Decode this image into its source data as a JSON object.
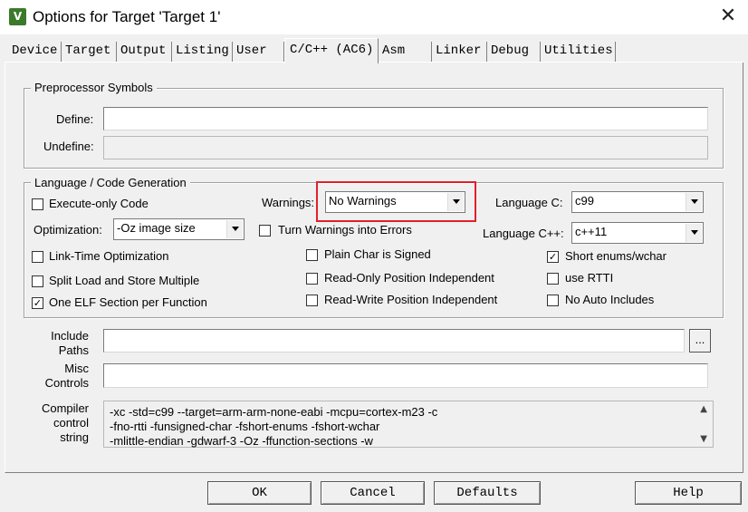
{
  "window": {
    "title": "Options for Target 'Target 1'",
    "icon": "uvision-icon",
    "close_glyph": "✕"
  },
  "tabs": [
    {
      "label": "Device",
      "active": false
    },
    {
      "label": "Target",
      "active": false
    },
    {
      "label": "Output",
      "active": false
    },
    {
      "label": "Listing",
      "active": false
    },
    {
      "label": "User",
      "active": false
    },
    {
      "label": "C/C++ (AC6)",
      "active": true
    },
    {
      "label": "Asm",
      "active": false
    },
    {
      "label": "Linker",
      "active": false
    },
    {
      "label": "Debug",
      "active": false
    },
    {
      "label": "Utilities",
      "active": false
    }
  ],
  "preprocessor": {
    "legend": "Preprocessor Symbols",
    "define_label": "Define:",
    "define_value": "",
    "undefine_label": "Undefine:",
    "undefine_value": ""
  },
  "codegen": {
    "legend": "Language / Code Generation",
    "execute_only": {
      "label": "Execute-only Code",
      "checked": false
    },
    "optimization_label": "Optimization:",
    "optimization_value": "-Oz image size",
    "lto": {
      "label": "Link-Time Optimization",
      "checked": false
    },
    "split_ldm": {
      "label": "Split Load and Store Multiple",
      "checked": false
    },
    "one_elf": {
      "label": "One ELF Section per Function",
      "checked": true
    },
    "warnings_label": "Warnings:",
    "warnings_value": "No Warnings",
    "warnings_to_errors": {
      "label": "Turn Warnings into Errors",
      "checked": false
    },
    "plain_char": {
      "label": "Plain Char is Signed",
      "checked": false
    },
    "ropi": {
      "label": "Read-Only Position Independent",
      "checked": false
    },
    "rwpi": {
      "label": "Read-Write Position Independent",
      "checked": false
    },
    "language_c_label": "Language C:",
    "language_c_value": "c99",
    "language_cpp_label": "Language C++:",
    "language_cpp_value": "c++11",
    "short_enums": {
      "label": "Short enums/wchar",
      "checked": true
    },
    "rtti": {
      "label": "use RTTI",
      "checked": false
    },
    "no_auto_includes": {
      "label": "No Auto Includes",
      "checked": false
    }
  },
  "include_paths": {
    "label_line1": "Include",
    "label_line2": "Paths",
    "value": "",
    "browse_label": "..."
  },
  "misc_controls": {
    "label_line1": "Misc",
    "label_line2": "Controls",
    "value": ""
  },
  "compiler_control": {
    "label_line1": "Compiler",
    "label_line2": "control",
    "label_line3": "string",
    "lines": [
      "-xc -std=c99 --target=arm-arm-none-eabi -mcpu=cortex-m23 -c",
      "-fno-rtti -funsigned-char -fshort-enums -fshort-wchar",
      "-mlittle-endian -gdwarf-3 -Oz -ffunction-sections -w"
    ]
  },
  "buttons": {
    "ok": "OK",
    "cancel": "Cancel",
    "defaults": "Defaults",
    "help": "Help"
  },
  "colors": {
    "highlight": "#e0212c"
  }
}
